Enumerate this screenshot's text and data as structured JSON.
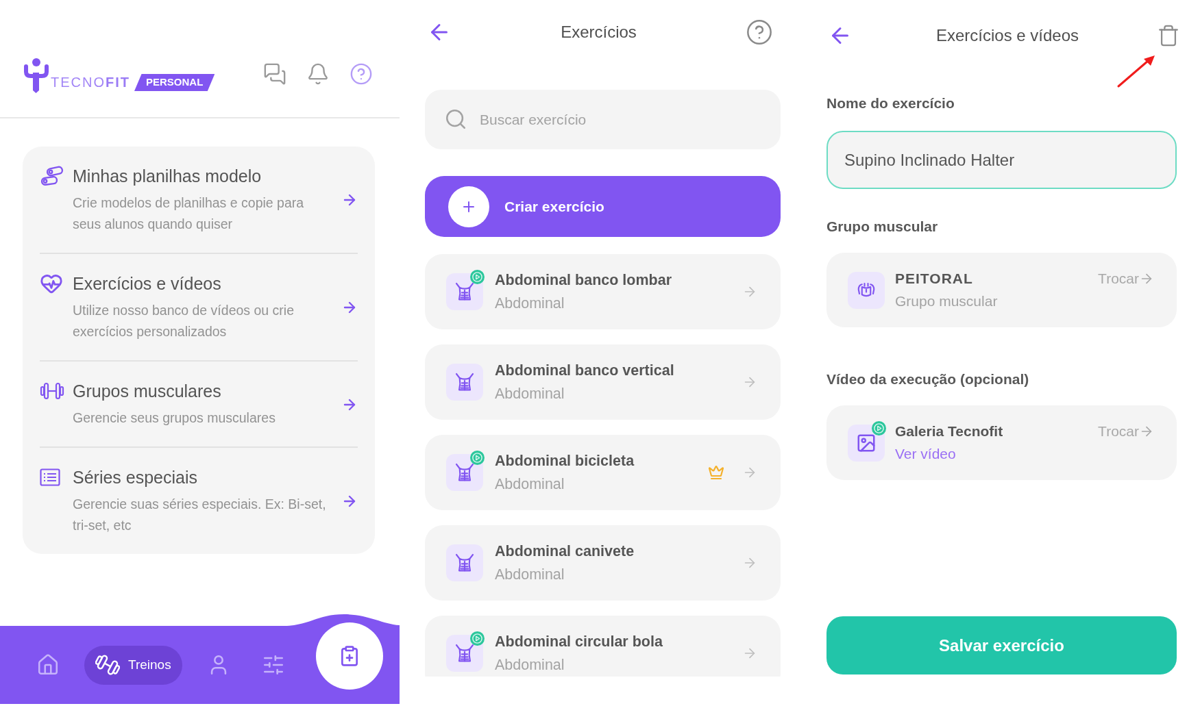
{
  "home_panel": {
    "logo": {
      "wordmark": "TECNO**FIT**",
      "tag": "PERSONAL"
    },
    "menu": [
      {
        "title": "Minhas planilhas modelo",
        "description": "Crie modelos de planilhas e copie para seus alunos quando quiser"
      },
      {
        "title": "Exercícios e vídeos",
        "description": "Utilize nosso banco de vídeos ou crie exercícios personalizados"
      },
      {
        "title": "Grupos musculares",
        "description": "Gerencie seus grupos musculares"
      },
      {
        "title": "Séries especiais",
        "description": "Gerencie suas séries especiais. Ex: Bi-set, tri-set, etc"
      }
    ],
    "bottom_nav": {
      "items": [
        {
          "selected": false
        },
        {
          "label": "Treinos",
          "selected": true
        },
        {
          "selected": false
        },
        {
          "selected": false
        }
      ]
    }
  },
  "exercises_panel": {
    "title": "Exercícios",
    "search": {
      "placeholder": "Buscar exercício"
    },
    "create_button": "Criar exercício",
    "exercises": [
      {
        "name": "Abdominal banco lombar",
        "group": "Abdominal",
        "video_badge": true,
        "crown": false
      },
      {
        "name": "Abdominal banco vertical",
        "group": "Abdominal",
        "video_badge": false,
        "crown": false
      },
      {
        "name": "Abdominal bicicleta",
        "group": "Abdominal",
        "video_badge": true,
        "crown": true
      },
      {
        "name": "Abdominal canivete",
        "group": "Abdominal",
        "video_badge": false,
        "crown": false
      },
      {
        "name": "Abdominal circular bola",
        "group": "Abdominal",
        "video_badge": true,
        "crown": false
      }
    ]
  },
  "edit_panel": {
    "title": "Exercícios e vídeos",
    "name_field": {
      "label": "Nome do exercício",
      "value": "Supino Inclinado Halter",
      "focused": true
    },
    "muscle_group": {
      "label": "Grupo muscular",
      "name": "PEITORAL",
      "caption": "Grupo muscular",
      "action": "Trocar"
    },
    "video": {
      "label": "Vídeo da execução (opcional)",
      "source": "Galeria Tecnofit",
      "link": "Ver vídeo",
      "action": "Trocar",
      "video_badge": true
    },
    "save_button": "Salvar exercício"
  }
}
